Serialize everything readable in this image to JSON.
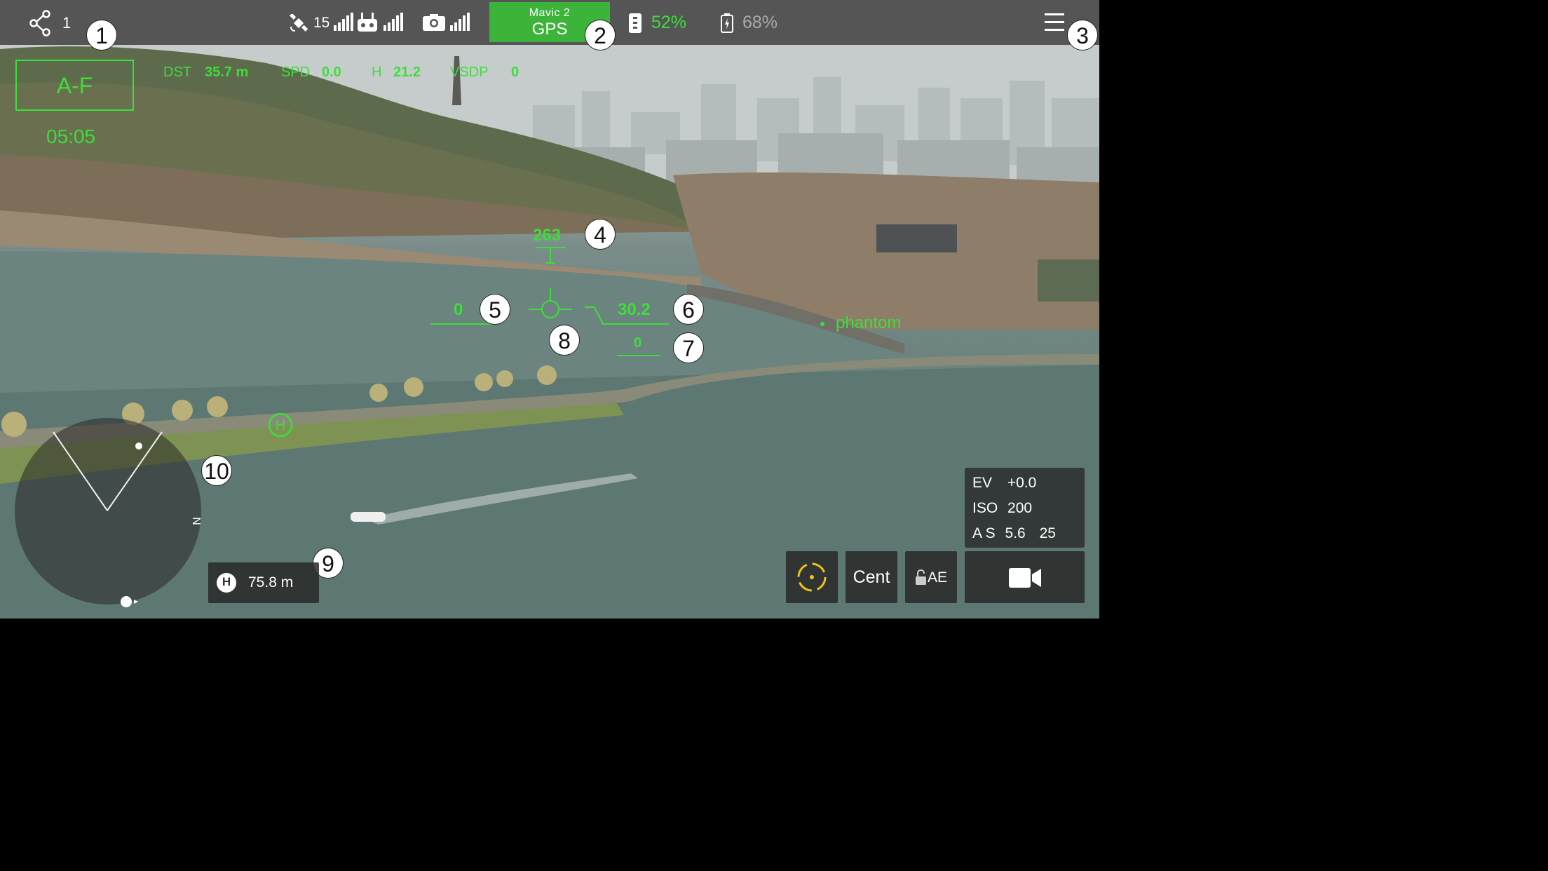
{
  "topbar": {
    "share_count": "1",
    "satellite_count": "15",
    "mode_model": "Mavic 2",
    "mode_value": "GPS",
    "aircraft_battery": "52%",
    "rc_battery": "68%"
  },
  "hud": {
    "af_label": "A-F",
    "timer": "05:05",
    "telemetry": {
      "dst_label": "DST",
      "dst_value": "35.7 m",
      "spd_label": "SPD",
      "spd_value": "0.0",
      "h_label": "H",
      "h_value": "21.2",
      "vsdp_label": "VSDP",
      "vsdp_value": "0"
    },
    "heading": "263",
    "speed_tape": "0",
    "altitude_tape": "30.2",
    "vertical_speed": "0",
    "target_label": "phantom"
  },
  "callouts": [
    "1",
    "2",
    "3",
    "4",
    "5",
    "6",
    "7",
    "8",
    "9",
    "10"
  ],
  "radar": {
    "north_label": "N"
  },
  "home_distance": {
    "icon_label": "H",
    "value": "75.8 m"
  },
  "camera_settings": {
    "ev_label": "EV",
    "ev_value": "+0.0",
    "iso_label": "ISO",
    "iso_value": "200",
    "as_label": "A S",
    "aperture": "5.6",
    "shutter": "25"
  },
  "buttons": {
    "center_label": "Cent",
    "ae_label": "AE"
  },
  "colors": {
    "hud_green": "#3dde3a",
    "mode_green": "#3cb43a",
    "topbar_gray": "#555555"
  },
  "icons": [
    "share-icon",
    "satellite-icon",
    "remote-controller-icon",
    "camera-signal-icon",
    "battery-icon",
    "rc-battery-icon",
    "menu-icon",
    "target-focus-icon",
    "lock-icon",
    "video-camera-icon",
    "home-point-icon"
  ]
}
